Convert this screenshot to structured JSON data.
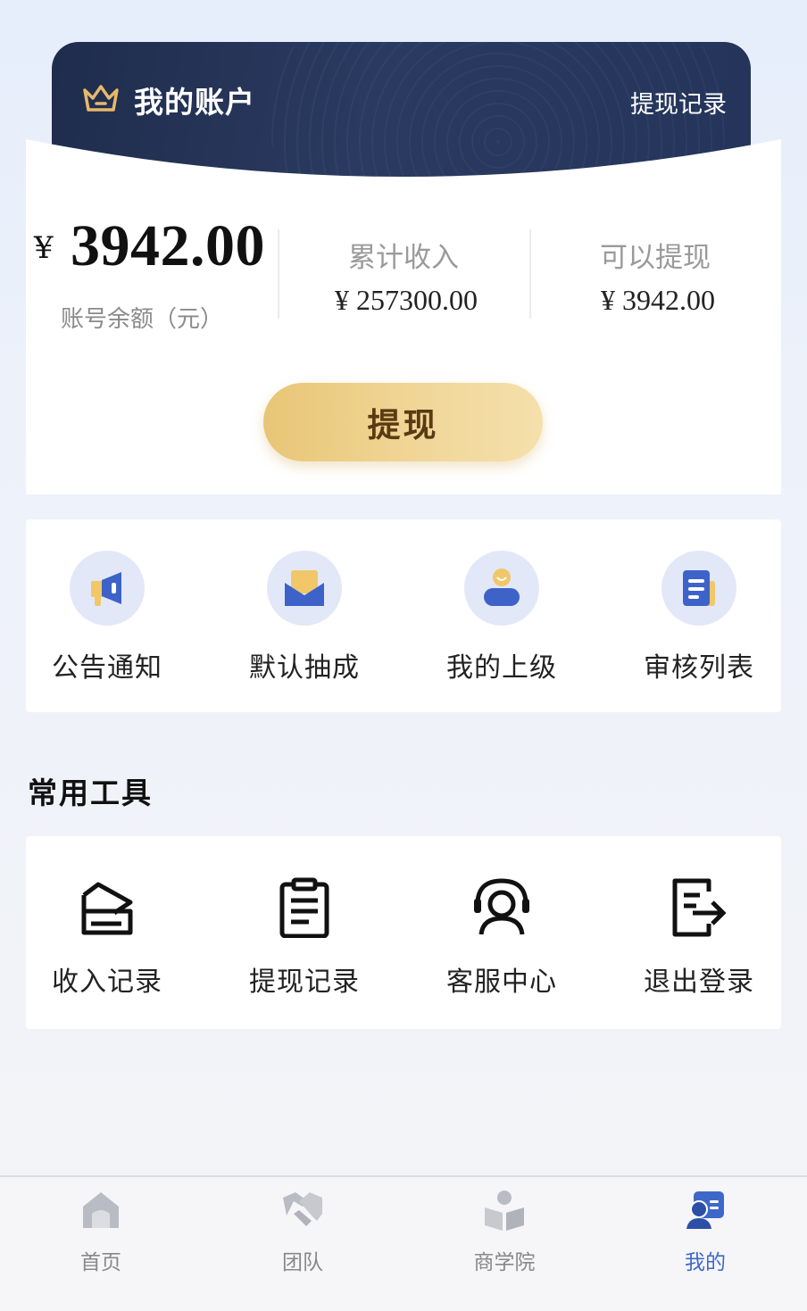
{
  "account": {
    "title": "我的账户",
    "history_link": "提现记录",
    "currency_symbol": "¥",
    "balance": "3942.00",
    "balance_label": "账号余额（元）",
    "total_income_label": "累计收入",
    "total_income_value": "¥ 257300.00",
    "withdrawable_label": "可以提现",
    "withdrawable_value": "¥ 3942.00",
    "withdraw_button": "提现"
  },
  "quick_menu": [
    {
      "label": "公告通知",
      "icon": "megaphone-icon"
    },
    {
      "label": "默认抽成",
      "icon": "envelope-icon"
    },
    {
      "label": "我的上级",
      "icon": "person-icon"
    },
    {
      "label": "审核列表",
      "icon": "document-list-icon"
    }
  ],
  "tools": {
    "section_title": "常用工具",
    "items": [
      {
        "label": "收入记录",
        "icon": "income-box-icon"
      },
      {
        "label": "提现记录",
        "icon": "clipboard-icon"
      },
      {
        "label": "客服中心",
        "icon": "headset-icon"
      },
      {
        "label": "退出登录",
        "icon": "logout-icon"
      }
    ]
  },
  "tabbar": {
    "items": [
      {
        "label": "首页",
        "icon": "home-icon",
        "active": false
      },
      {
        "label": "团队",
        "icon": "handshake-icon",
        "active": false
      },
      {
        "label": "商学院",
        "icon": "academy-icon",
        "active": false
      },
      {
        "label": "我的",
        "icon": "profile-icon",
        "active": true
      }
    ]
  },
  "colors": {
    "header_bg": "#1f2c4c",
    "button_gold": "#ecce85",
    "accent_blue": "#3e68c8",
    "icon_yellow": "#f0c86a"
  }
}
